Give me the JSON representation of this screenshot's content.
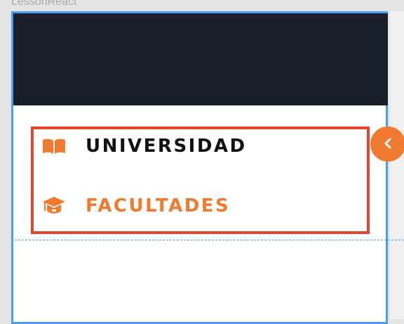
{
  "window": {
    "app_label": "LessonReact"
  },
  "menu": {
    "items": [
      {
        "label": "UNIVERSIDAD",
        "icon": "book-open-icon",
        "color": "#111111"
      },
      {
        "label": "FACULTADES",
        "icon": "graduation-cap-icon",
        "color": "#f07a30"
      }
    ]
  },
  "sidebar_toggle": {
    "icon": "chevron-left-icon",
    "color": "#f07a30"
  },
  "colors": {
    "header_bg": "#181e2a",
    "accent": "#f07a30",
    "selection_outline": "#e4452d",
    "frame_outline": "#4a9fe8"
  }
}
